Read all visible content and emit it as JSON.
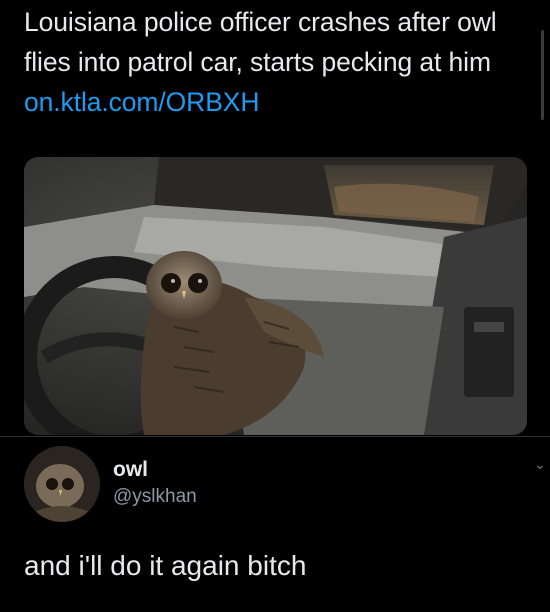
{
  "tweet": {
    "text": "Louisiana police officer crashes after owl flies into patrol car, starts pecking at him",
    "link": "on.ktla.com/ORBXH"
  },
  "media": {
    "icon": "photo-owl-in-patrol-car"
  },
  "reply": {
    "display_name": "owl",
    "handle": "@yslkhan",
    "text": "and i'll do it again bitch"
  },
  "colors": {
    "background": "#000000",
    "text": "#e7e9ea",
    "link": "#1d9bf0",
    "secondary": "#8b98a5"
  }
}
